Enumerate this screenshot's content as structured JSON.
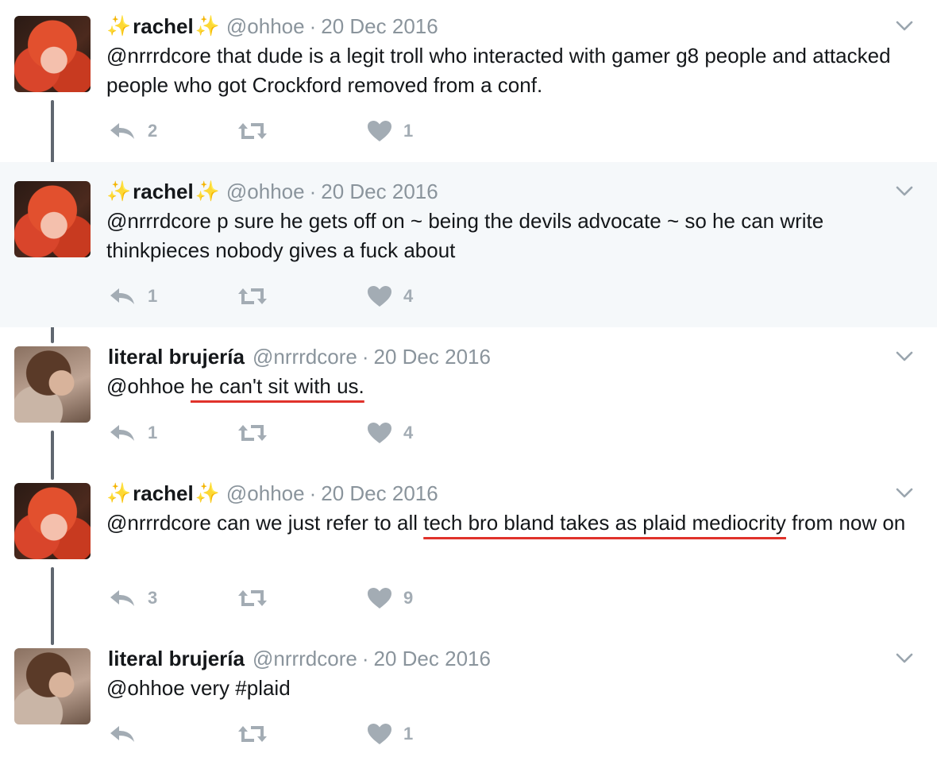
{
  "tweets": [
    {
      "name": "rachel",
      "handle": "@ohhoe",
      "separator": "·",
      "date": "20 Dec 2016",
      "mention": "@nrrrdcore",
      "text_plain": "that dude is a legit troll who interacted with gamer g8 people and attacked people who got Crockford removed from a conf.",
      "replies": "2",
      "retweets": "",
      "likes": "1"
    },
    {
      "name": "rachel",
      "handle": "@ohhoe",
      "separator": "·",
      "date": "20 Dec 2016",
      "mention": "@nrrrdcore",
      "text_plain": "p sure he gets off on ~ being the devils advocate ~ so he can write thinkpieces nobody gives a fuck about",
      "replies": "1",
      "retweets": "",
      "likes": "4"
    },
    {
      "name": "literal brujería",
      "handle": "@nrrrdcore",
      "separator": "·",
      "date": "20 Dec 2016",
      "mention": "@ohhoe",
      "text_underlined": "he can't sit with us.",
      "replies": "1",
      "retweets": "",
      "likes": "4"
    },
    {
      "name": "rachel",
      "handle": "@ohhoe",
      "separator": "·",
      "date": "20 Dec 2016",
      "mention": "@nrrrdcore",
      "text_before": "can we just refer to all",
      "text_underlined": "tech bro bland takes as plaid mediocrity",
      "text_after": "from now on",
      "replies": "3",
      "retweets": "",
      "likes": "9"
    },
    {
      "name": "literal brujería",
      "handle": "@nrrrdcore",
      "separator": "·",
      "date": "20 Dec 2016",
      "mention": "@ohhoe",
      "text_plain": "very #plaid",
      "replies": "",
      "retweets": "",
      "likes": "1"
    }
  ],
  "sparkle_glyph": "✨",
  "colors": {
    "highlight_bg": "#f5f8fa",
    "meta_gray": "#8a949c",
    "icon_gray": "#a3acb4",
    "underline_red": "#e0322b",
    "thread_line": "#606770"
  }
}
